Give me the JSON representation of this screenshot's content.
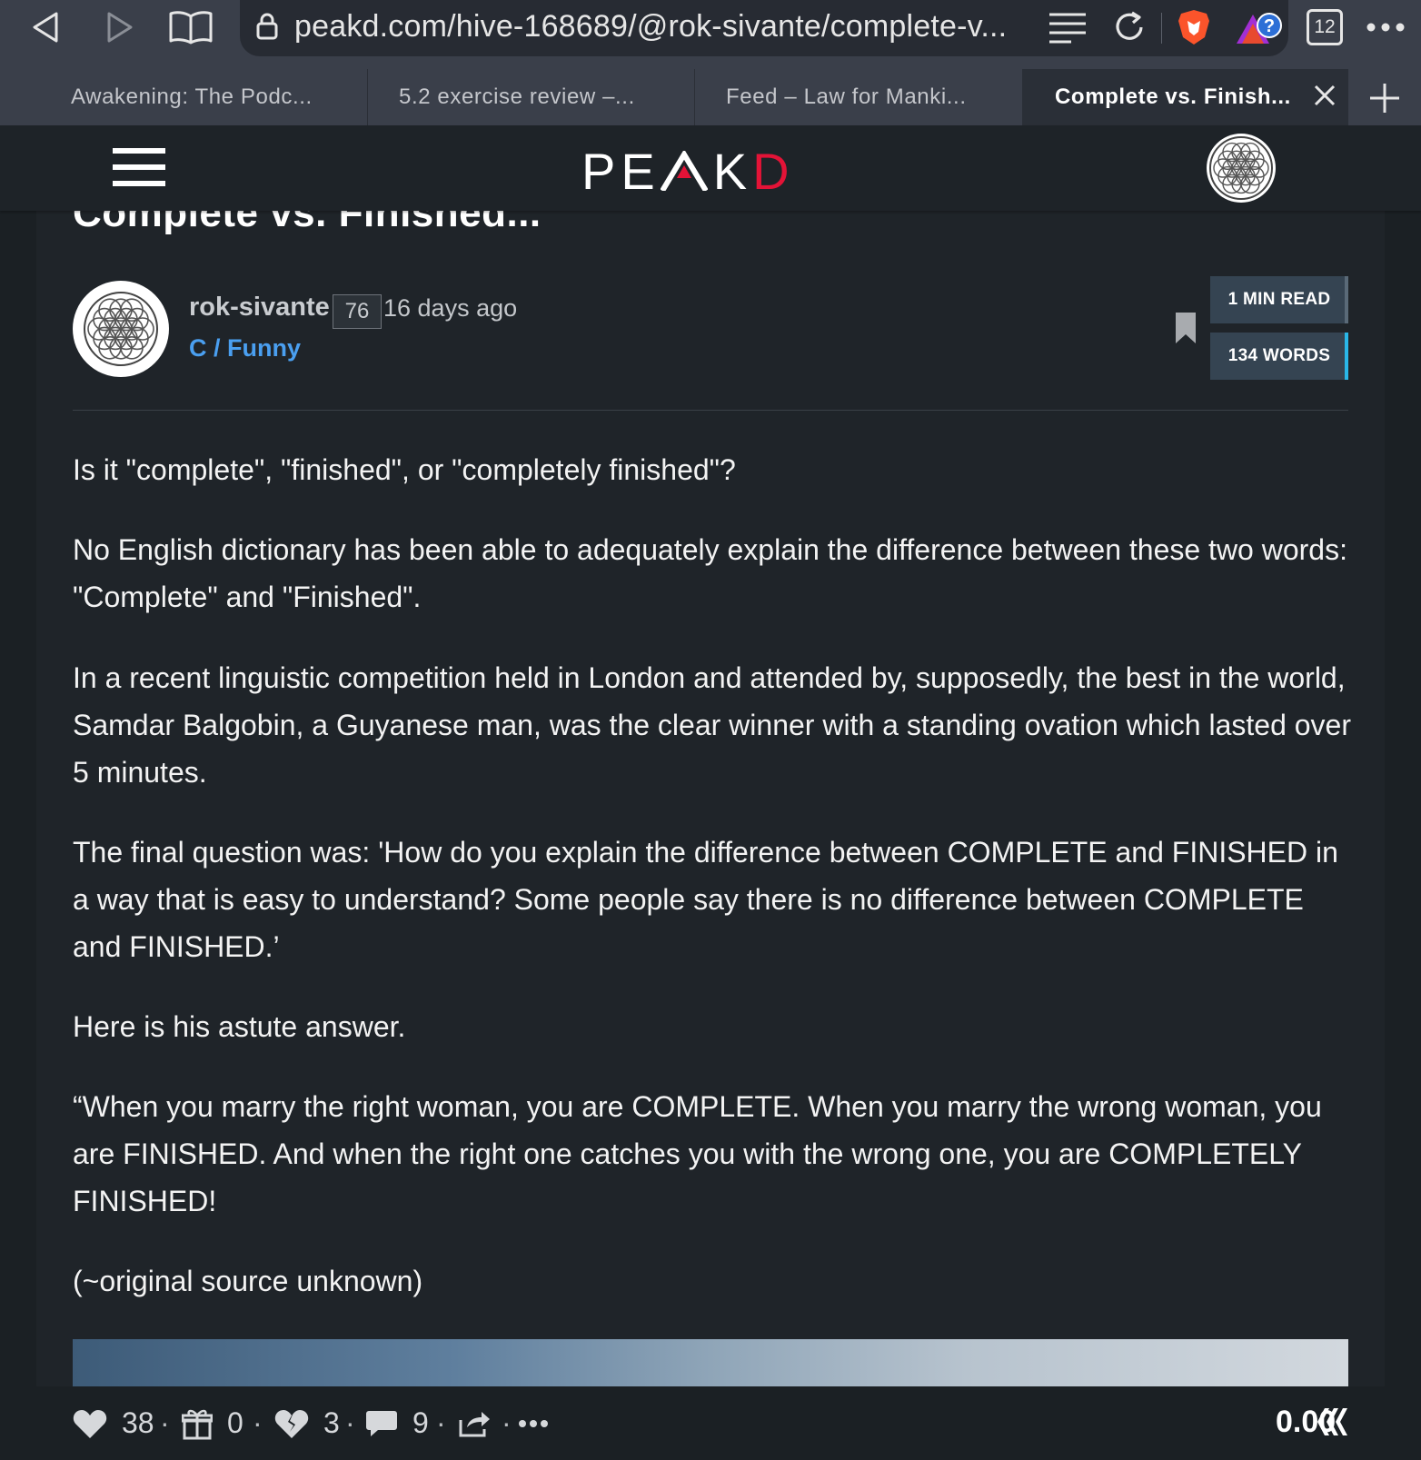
{
  "browser": {
    "url": "peakd.com/hive-168689/@rok-sivante/complete-v...",
    "tab_count": "12",
    "tabs": [
      {
        "label": "Awakening: The Podc..."
      },
      {
        "label": "5.2 exercise review –..."
      },
      {
        "label": "Feed – Law for Manki..."
      },
      {
        "label": "Complete vs. Finish...",
        "active": true
      }
    ]
  },
  "site": {
    "logo_main": "PE",
    "logo_mid": "K",
    "logo_end": "D"
  },
  "post": {
    "title": "Complete vs. Finished...",
    "author": "rok-sivante",
    "reputation": "76",
    "posted": "16 days ago",
    "community": "C / Funny",
    "read_time": "1 MIN READ",
    "word_count": "134 WORDS",
    "paragraphs": [
      "Is it \"complete\", \"finished\", or \"completely finished\"?",
      "No English dictionary has been able to adequately explain the difference between these two words: \"Complete\" and \"Finished\".",
      "In a recent linguistic competition held in London and attended by, supposedly, the best in the world, Samdar Balgobin, a Guyanese man, was the clear winner with a standing ovation which lasted over 5 minutes.",
      "The final question was: 'How do you explain the difference between COMPLETE and FINISHED in a way that is easy to understand? Some people say there is no difference between COMPLETE and FINISHED.’",
      "Here is his astute answer.",
      "“When you marry the right woman, you are COMPLETE. When you marry the wrong woman, you are FINISHED. And when the right one catches you with the wrong one, you are COMPLETELY FINISHED!",
      "(~original source unknown)"
    ]
  },
  "footer": {
    "votes": "38",
    "tips": "0",
    "downvotes": "3",
    "comments": "9",
    "payout": "0.00",
    "separator": "·"
  },
  "colors": {
    "accent_blue": "#4a9ff0",
    "brand_red": "#e31337",
    "stat_box": "#354452",
    "stat_accent": "#2ab7e8"
  }
}
